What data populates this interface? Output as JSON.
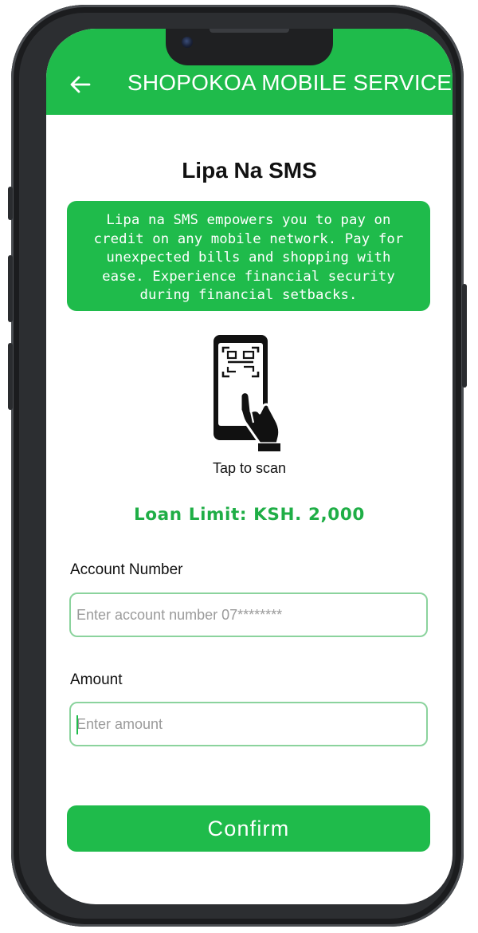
{
  "colors": {
    "brand_green": "#1fbb4b",
    "loan_green": "#1fae46",
    "field_border": "#8bd39d",
    "phone_frame": "#2c2e31"
  },
  "app_bar": {
    "back_icon": "arrow-left-icon",
    "title": "SHOPOKOA MOBILE SERVICES"
  },
  "page": {
    "title": "Lipa Na SMS",
    "description": "Lipa na SMS empowers you to pay on credit on any mobile network. Pay for unexpected bills and shopping with ease. Experience financial security during financial setbacks."
  },
  "scan": {
    "icon": "phone-scan-qr-icon",
    "label": "Tap to scan"
  },
  "loan_limit": {
    "text": "Loan Limit: KSH. 2,000"
  },
  "form": {
    "account_number": {
      "label": "Account Number",
      "value": "",
      "placeholder": "Enter account number 07********"
    },
    "amount": {
      "label": "Amount",
      "value": "",
      "placeholder": "Enter amount"
    },
    "confirm_label": "Confirm"
  }
}
